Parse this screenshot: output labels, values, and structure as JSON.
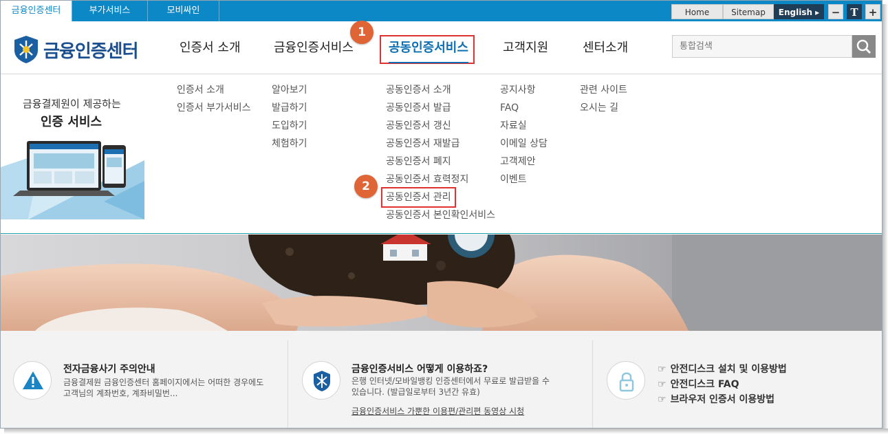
{
  "site_tabs": [
    "금융인증센터",
    "부가서비스",
    "모비싸인"
  ],
  "utility": {
    "home": "Home",
    "sitemap": "Sitemap",
    "english": "English ▸",
    "zoom_out": "−",
    "text": "T",
    "zoom_in": "+"
  },
  "logo": {
    "text": "금융인증센터"
  },
  "gnb": [
    "인증서 소개",
    "금융인증서비스",
    "공동인증서비스",
    "고객지원",
    "센터소개"
  ],
  "search": {
    "placeholder": "통합검색"
  },
  "badges": {
    "one": "1",
    "two": "2"
  },
  "promo": {
    "line1": "금융결제원이 제공하는",
    "line2": "인증 서비스"
  },
  "menu": {
    "col1": [
      "인증서 소개",
      "인증서 부가서비스"
    ],
    "col2": [
      "알아보기",
      "발급하기",
      "도입하기",
      "체험하기"
    ],
    "col3": [
      "공동인증서 소개",
      "공동인증서 발급",
      "공동인증서 갱신",
      "공동인증서 재발급",
      "공동인증서 폐지",
      "공동인증서 효력정지",
      "공동인증서 관리",
      "공동인증서 본인확인서비스"
    ],
    "col4": [
      "공지사항",
      "FAQ",
      "자료실",
      "이메일 상담",
      "고객제안",
      "이벤트"
    ],
    "col5": [
      "관련 사이트",
      "오시는 길"
    ]
  },
  "info": {
    "p1": {
      "title": "전자금융사기 주의안내",
      "desc": "금융결제원 금융인증센터 홈페이지에서는 어떠한 경우에도 고객님의 계좌번호, 계좌비밀번..."
    },
    "p2": {
      "title": "금융인증서비스 어떻게 이용하죠?",
      "desc": "은행 인터넷/모바일뱅킹 인증센터에서 무료로 발급받을 수 있습니다. (발급일로부터 3년간 유효)",
      "link": "금융인증서비스 가뿐한 이용편/관리편 동영상 시청"
    },
    "p3": {
      "links": [
        "안전디스크 설치 및 이용방법",
        "안전디스크 FAQ",
        "브라우저 인증서 이용방법"
      ],
      "bullet": "☞"
    }
  }
}
